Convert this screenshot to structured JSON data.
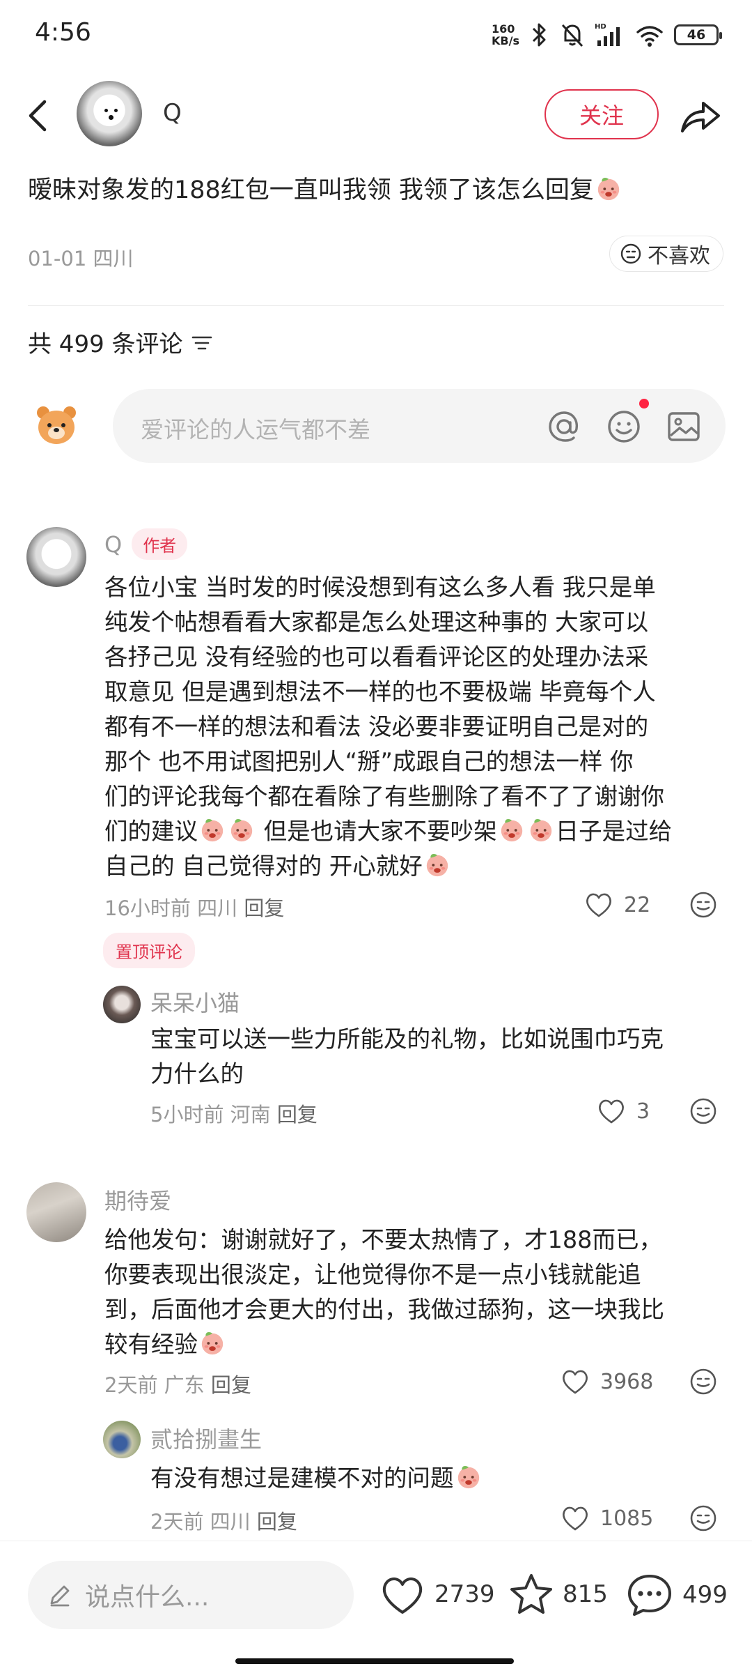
{
  "status_bar": {
    "time": "4:56",
    "net_speed_value": "160",
    "net_speed_unit": "KB/s",
    "battery": "46"
  },
  "header": {
    "author_name": "Q",
    "follow_label": "关注"
  },
  "post": {
    "title": "暧昧对象发的188红包一直叫我领 我领了该怎么回复",
    "date_location": "01-01 四川",
    "dislike_label": "不喜欢"
  },
  "comments_header": {
    "count_label": "共 499 条评论"
  },
  "comment_input": {
    "placeholder": "爱评论的人运气都不差"
  },
  "comments": [
    {
      "author": "Q",
      "author_tag": "作者",
      "lines": [
        "各位小宝 当时发的时候没想到有这么多人看 我只是单",
        "纯发个帖想看看大家都是怎么处理这种事的 大家可以",
        "各抒己见 没有经验的也可以看看评论区的处理办法采",
        "取意见 但是遇到想法不一样的也不要极端 毕竟每个人",
        "都有不一样的想法和看法 没必要非要证明自己是对的",
        "那个 也不用试图把别人“掰”成跟自己的想法一样 你",
        "们的评论我每个都在看除了有些删除了看不了了谢谢你"
      ],
      "line8_a": "们的建议",
      "line8_b": " 但是也请大家不要吵架",
      "line8_c": "日子是过给",
      "line9": "自己的 自己觉得对的 开心就好",
      "meta": "16小时前 四川",
      "reply_label": "回复",
      "likes": "22",
      "pinned_label": "置顶评论",
      "replies": [
        {
          "author": "呆呆小猫",
          "lines": [
            "宝宝可以送一些力所能及的礼物，比如说围巾巧克",
            "力什么的"
          ],
          "meta": "5小时前 河南",
          "reply_label": "回复",
          "likes": "3"
        }
      ]
    },
    {
      "author": "期待爱",
      "lines": [
        "给他发句：谢谢就好了，不要太热情了，才188而已，",
        "你要表现出很淡定，让他觉得你不是一点小钱就能追",
        "到，后面他才会更大的付出，我做过舔狗，这一块我比",
        "较有经验"
      ],
      "meta": "2天前 广东",
      "reply_label": "回复",
      "likes": "3968",
      "replies": [
        {
          "author": "贰拾捌畫生",
          "text": "有没有想过是建模不对的问题",
          "meta": "2天前 四川",
          "reply_label": "回复",
          "likes": "1085"
        }
      ]
    }
  ],
  "bottom_bar": {
    "placeholder": "说点什么...",
    "likes": "2739",
    "favorites": "815",
    "comments": "499"
  },
  "colors": {
    "accent": "#e0334d",
    "muted": "#999999",
    "input_bg": "#f4f4f4"
  },
  "icons": [
    "back-icon",
    "share-icon",
    "dislike-face-icon",
    "filter-icon",
    "at-icon",
    "emoji-icon",
    "image-icon",
    "heart-icon",
    "reaction-face-icon",
    "pencil-icon",
    "star-icon",
    "chat-bubble-icon",
    "peach-emoji-icon"
  ]
}
